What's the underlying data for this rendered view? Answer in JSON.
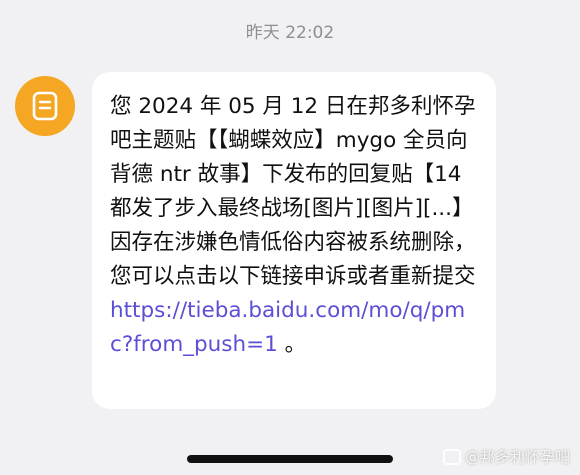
{
  "header": {
    "timestamp": "昨天 22:02"
  },
  "sender": {
    "avatar_icon": "message-doc-icon",
    "avatar_color": "#f5a623"
  },
  "message": {
    "text": "您 2024 年 05 月 12 日在邦多利怀孕吧主题贴【【蝴蝶效应】mygo 全员向背德 ntr 故事】下发布的回复贴【14 都发了步入最终战场[图片][图片][...】因存在涉嫌色情低俗内容被系统删除，您可以点击以下链接申诉或者重新提交",
    "link": "https://tieba.baidu.com/mo/q/pmc?from_push=1",
    "end": " 。",
    "link_color": "#5b4fd6"
  },
  "watermark": {
    "text": "@邦多利怀孕吧"
  }
}
